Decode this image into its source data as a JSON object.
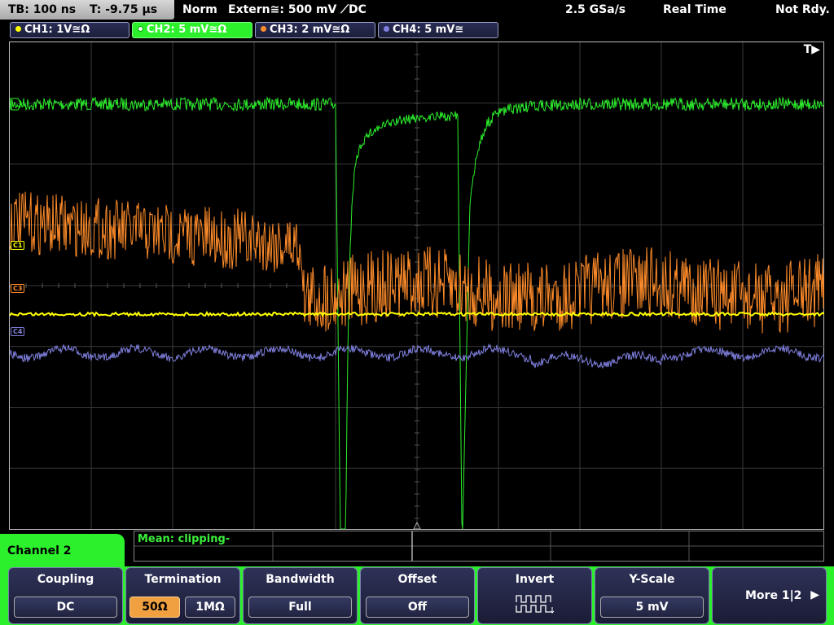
{
  "topbar": {
    "timebase": "TB: 100 ns",
    "trigger_time": "T: -9.75 µs",
    "trigger_mode": "Norm",
    "trigger_source": "Extern≅: 500 mV ⟋DC",
    "sample_rate": "2.5 GSa/s",
    "acq_mode": "Real Time",
    "status": "Not Rdy."
  },
  "channels": [
    {
      "label": "CH1: 1V≅Ω",
      "color": "#ffff00",
      "active": false
    },
    {
      "label": "CH2: 5 mV≅Ω",
      "color": "#2cf02c",
      "active": true
    },
    {
      "label": "CH3: 2 mV≅Ω",
      "color": "#ff8c2a",
      "active": false
    },
    {
      "label": "CH4: 5 mV≅",
      "color": "#8080e0",
      "active": false
    }
  ],
  "screen": {
    "trigger_flag": "T▶",
    "markers": {
      "c1": "C1",
      "c3": "C3",
      "c4": "C4"
    }
  },
  "measurement": {
    "text": "Mean: clipping-"
  },
  "menu": {
    "title": "Channel 2",
    "coupling": {
      "label": "Coupling",
      "value": "DC"
    },
    "termination": {
      "label": "Termination",
      "opt_a": "50Ω",
      "opt_b": "1MΩ"
    },
    "bandwidth": {
      "label": "Bandwidth",
      "value": "Full"
    },
    "offset": {
      "label": "Offset",
      "value": "Off"
    },
    "invert": {
      "label": "Invert"
    },
    "yscale": {
      "label": "Y-Scale",
      "value": "5 mV"
    },
    "more": {
      "label": "More 1|2"
    }
  }
}
